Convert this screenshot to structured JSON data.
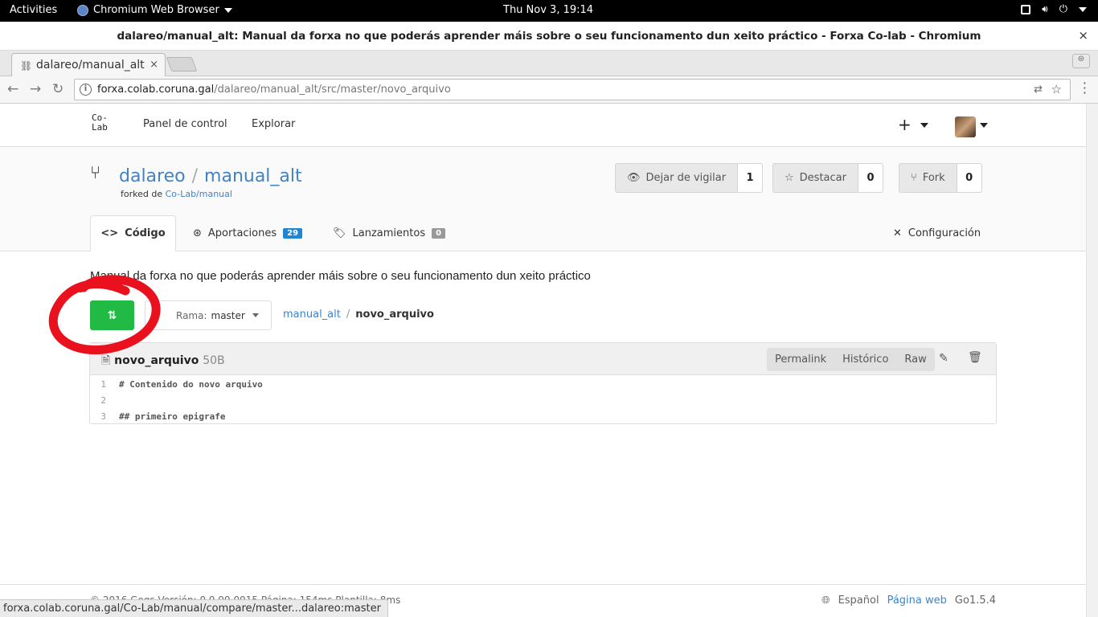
{
  "system": {
    "activities": "Activities",
    "app_name": "Chromium Web Browser",
    "clock": "Thu Nov  3, 19:14"
  },
  "window": {
    "title": "dalareo/manual_alt: Manual da forxa no que poderás aprender máis sobre o seu funcionamento dun xeito práctico - Forxa Co-lab - Chromium",
    "close": "×"
  },
  "tab": {
    "label": "dalareo/manual_alt",
    "close": "×"
  },
  "omnibox": {
    "host": "forxa.colab.coruna.gal",
    "path": "/dalareo/manual_alt/src/master/novo_arquivo"
  },
  "site": {
    "logo_line1": "Co-",
    "logo_line2": "Lab",
    "nav": [
      "Panel de control",
      "Explorar"
    ],
    "plus": "+"
  },
  "repo": {
    "owner": "dalareo",
    "separator": "/",
    "name": "manual_alt",
    "forked_label": "forked de",
    "forked_from": "Co-Lab/manual",
    "watch_label": "Dejar de vigilar",
    "watch_count": "1",
    "star_label": "Destacar",
    "star_count": "0",
    "fork_label": "Fork",
    "fork_count": "0"
  },
  "tabs": {
    "code": "Código",
    "pulls": "Aportaciones",
    "pulls_count": "29",
    "releases": "Lanzamientos",
    "releases_count": "0",
    "settings": "Configuración"
  },
  "description": "Manual da forxa no que poderás aprender máis sobre o seu funcionamento dun xeito práctico",
  "branch": {
    "label": "Rama:",
    "value": "master"
  },
  "breadcrumb": {
    "repo": "manual_alt",
    "sep": "/",
    "file": "novo_arquivo"
  },
  "file": {
    "name": "novo_arquivo",
    "size": "50B",
    "actions": [
      "Permalink",
      "Histórico",
      "Raw"
    ],
    "lines": [
      {
        "n": "1",
        "text": "# Contenido do novo arquivo"
      },
      {
        "n": "2",
        "text": ""
      },
      {
        "n": "3",
        "text": "## primeiro epigrafe"
      }
    ]
  },
  "footer": {
    "copyright": "© 2016 Gogs Versión: 0.9.99.0915 Página: 154ms Plantilla: 8ms",
    "language": "Español",
    "website": "Página web",
    "go_version": "Go1.5.4"
  },
  "status_url": "forxa.colab.coruna.gal/Co-Lab/manual/compare/master...dalareo:master",
  "colors": {
    "accent": "#4183c4",
    "green": "#21ba45",
    "annotation": "#e8111d"
  }
}
